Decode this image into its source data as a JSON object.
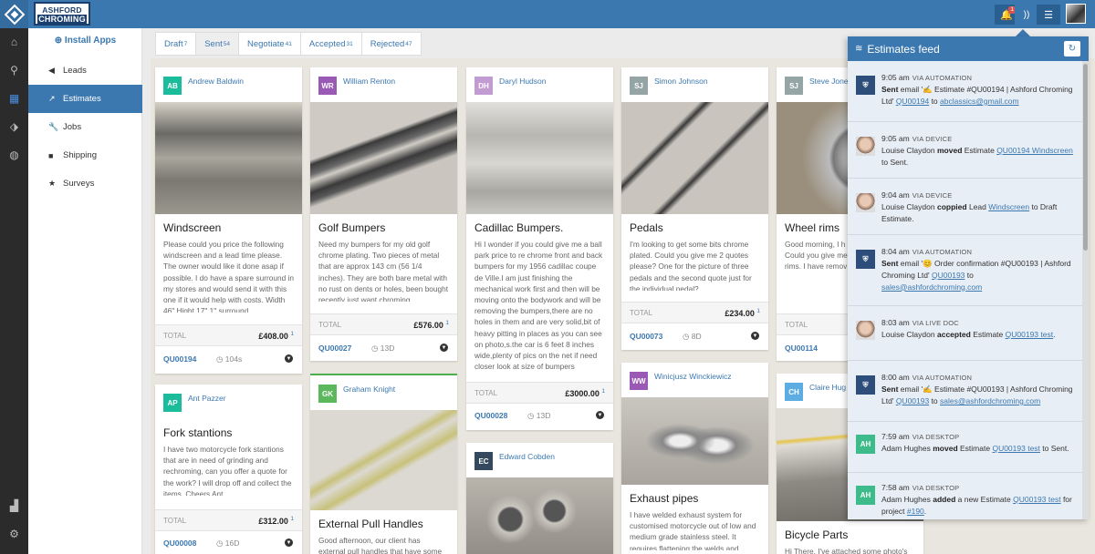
{
  "brand": {
    "line1": "ASHFORD",
    "line2": "CHROMING"
  },
  "topbar": {
    "notif_count": "1"
  },
  "sidebar": {
    "install": "Install Apps",
    "items": [
      {
        "label": "Leads",
        "icon": "megaphone-icon"
      },
      {
        "label": "Estimates",
        "icon": "chart-icon"
      },
      {
        "label": "Jobs",
        "icon": "wrench-icon"
      },
      {
        "label": "Shipping",
        "icon": "truck-icon"
      },
      {
        "label": "Surveys",
        "icon": "star-icon"
      }
    ]
  },
  "tabs": [
    {
      "label": "Draft",
      "count": "7"
    },
    {
      "label": "Sent",
      "count": "54"
    },
    {
      "label": "Negotiate",
      "count": "41"
    },
    {
      "label": "Accepted",
      "count": "31"
    },
    {
      "label": "Rejected",
      "count": "47"
    }
  ],
  "cards": [
    {
      "initials": "AB",
      "name": "Andrew Baldwin",
      "title": "Windscreen",
      "desc": "Please could you price the following windscreen and a lead time please. The owner would like it done asap if possible. I do have a spare surround in my stores and would send it with this one if it would help with costs. Width 46\" Hight 17\" 1\" surround",
      "total_label": "TOTAL",
      "total": "£408.00",
      "total_count": "1",
      "ref": "QU00194",
      "age": "104s",
      "color": "#1abc9c"
    },
    {
      "initials": "AP",
      "name": "Ant Pazzer",
      "title": "Fork stantions",
      "desc": "I have two motorcycle fork stantions that are in need of grinding and rechroming, can you offer a quote for the work? I will drop off and collect the items. Cheers Ant.",
      "total_label": "TOTAL",
      "total": "£312.00",
      "total_count": "1",
      "ref": "QU00008",
      "age": "16D",
      "color": "#1abc9c"
    },
    {
      "initials": "WR",
      "name": "William Renton",
      "title": "Golf Bumpers",
      "desc": "Need my bumpers for my old golf chrome plating. Two pieces of metal that are approx 143 cm (56 1/4 inches). They are both bare metal with no rust on dents or holes, been bought recently just want chroming",
      "total_label": "TOTAL",
      "total": "£576.00",
      "total_count": "1",
      "ref": "QU00027",
      "age": "13D",
      "color": "#9b59b6"
    },
    {
      "initials": "GK",
      "name": "Graham Knight",
      "title": "External Pull Handles",
      "desc": "Good afternoon, our client has external pull handles that have some",
      "color": "#4cae4c"
    },
    {
      "initials": "DH",
      "name": "Daryl Hudson",
      "title": "Cadillac Bumpers.",
      "desc": "Hi I wonder if you could give me a ball park price to re chrome front and back bumpers for my 1956 cadillac coupe de Ville.I am just finishing the mechanical work first and then will be moving onto the bodywork and will be removing the bumpers,there are no holes in them and are very solid,bit of heavy pitting in places as you can see on photo,s.the car is 6 feet 8 inches wide,plenty of pics on the net if need closer look at size of bumpers",
      "total_label": "TOTAL",
      "total": "£3000.00",
      "total_count": "1",
      "ref": "QU00028",
      "age": "13D",
      "color": "#c39bd3"
    },
    {
      "initials": "EC",
      "name": "Edward Cobden",
      "color": "#34495e"
    },
    {
      "initials": "SJ",
      "name": "Simon Johnson",
      "title": "Pedals",
      "desc": "I'm looking to get some bits chrome plated. Could you give me 2 quotes please? One for the picture of three pedals and the second quote just for the individual pedal?",
      "total_label": "TOTAL",
      "total": "£234.00",
      "total_count": "1",
      "ref": "QU00073",
      "age": "8D",
      "color": "#95a5a6"
    },
    {
      "initials": "WW",
      "name": "Winicjusz Winckiewicz",
      "title": "Exhaust pipes",
      "desc": "I have welded exhaust system for customised motorcycle out of low and medium grade stainless steel. It requires flattening the welds and polishing. Instead to drop it and",
      "color": "#9b59b6"
    },
    {
      "initials": "SJ",
      "name": "Steve Jone",
      "title": "Wheel rims",
      "desc": "Good morning, I h to restore couple Could you give me cost to re-chrome rims. I have remov surface rust.",
      "total_label": "TOTAL",
      "ref": "QU00114",
      "color": "#95a5a6"
    },
    {
      "initials": "CH",
      "name": "Claire Hug",
      "title": "Bicycle Parts",
      "desc": "Hi There, I've attached some photo's",
      "color": "#5dade2"
    }
  ],
  "feed": {
    "title": "Estimates feed",
    "entries": [
      {
        "time": "9:05 am",
        "via": "VIA AUTOMATION",
        "avatar": "bot",
        "initials": "",
        "actor": "Sent",
        "action": " email '✍ Estimate #QU00194 | Ashford Chroming Ltd' ",
        "link1": "QU00194",
        "mid": " to ",
        "link2": "abclassics@gmail.com",
        "tail": ""
      },
      {
        "time": "9:05 am",
        "via": "VIA DEVICE",
        "avatar": "face",
        "initials": "",
        "actor": "Louise Claydon",
        "bold_verb": "moved",
        "action": " Estimate ",
        "link1": "QU00194 Windscreen",
        "mid": " to Sent.",
        "link2": "",
        "tail": ""
      },
      {
        "time": "9:04 am",
        "via": "VIA DEVICE",
        "avatar": "face",
        "initials": "",
        "actor": "Louise Claydon",
        "bold_verb": "coppied",
        "action": " Lead ",
        "link1": "Windscreen",
        "mid": " to Draft Estimate.",
        "link2": "",
        "tail": ""
      },
      {
        "time": "8:04 am",
        "via": "VIA AUTOMATION",
        "avatar": "bot",
        "initials": "",
        "actor": "Sent",
        "action": " email '😊 Order confirmation #QU00193 | Ashford Chroming Ltd' ",
        "link1": "QU00193",
        "mid": " to ",
        "link2": "sales@ashfordchroming.com",
        "tail": ""
      },
      {
        "time": "8:03 am",
        "via": "VIA LIVE DOC",
        "avatar": "face",
        "initials": "",
        "actor": "Louise Claydon",
        "bold_verb": "accepted",
        "action": " Estimate ",
        "link1": "QU00193 test",
        "mid": ".",
        "link2": "",
        "tail": ""
      },
      {
        "time": "8:00 am",
        "via": "VIA AUTOMATION",
        "avatar": "bot",
        "initials": "",
        "actor": "Sent",
        "action": " email '✍ Estimate #QU00193 | Ashford Chroming Ltd' ",
        "link1": "QU00193",
        "mid": " to ",
        "link2": "sales@ashfordchroming.com",
        "tail": ""
      },
      {
        "time": "7:59 am",
        "via": "VIA DESKTOP",
        "avatar": "ah",
        "initials": "AH",
        "actor": "Adam Hughes",
        "bold_verb": "moved",
        "action": " Estimate ",
        "link1": "QU00193 test",
        "mid": " to Sent.",
        "link2": "",
        "tail": ""
      },
      {
        "time": "7:58 am",
        "via": "VIA DESKTOP",
        "avatar": "ah",
        "initials": "AH",
        "actor": "Adam Hughes",
        "bold_verb": "added",
        "action": " a new Estimate ",
        "link1": "QU00193 test",
        "mid": " for project ",
        "link2": "#190",
        "tail": "."
      }
    ]
  }
}
